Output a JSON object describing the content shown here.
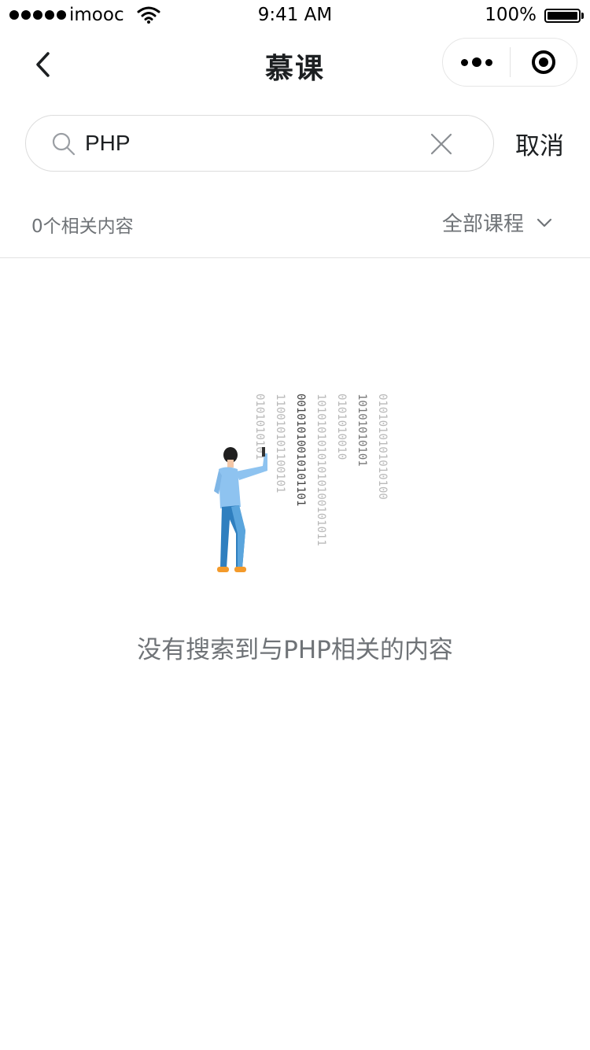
{
  "status_bar": {
    "carrier": "imooc",
    "time": "9:41 AM",
    "battery": "100%"
  },
  "nav": {
    "title": "慕课"
  },
  "search": {
    "value": "PHP",
    "cancel_label": "取消"
  },
  "filter": {
    "result_count": "0个相关内容",
    "category_label": "全部课程"
  },
  "empty_state": {
    "message": "没有搜索到与PHP相关的内容",
    "binary_columns": [
      "0101010101",
      "110010101100101",
      "00101010010101101",
      "10101010101010100101011",
      "0101010010",
      "10101010101",
      "0101010101010100"
    ]
  },
  "colors": {
    "text_primary": "#1c1f21",
    "text_secondary": "#6f7377",
    "border": "#dcdcdc",
    "figure_shirt": "#8ec3f0",
    "figure_pants": "#2f7fbf",
    "figure_shoes": "#f39a2b"
  }
}
